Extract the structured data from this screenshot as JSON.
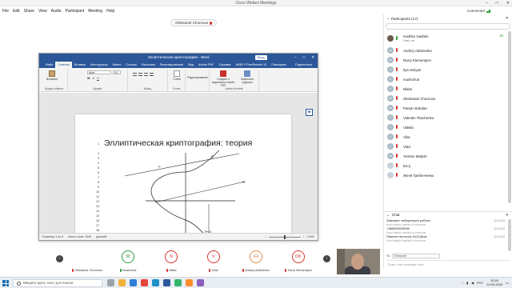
{
  "webex": {
    "title": "Cisco Webex Meetings",
    "menu": [
      "File",
      "Edit",
      "Share",
      "View",
      "Audio",
      "Participant",
      "Meeting",
      "Help"
    ],
    "connection_status": "Connected",
    "window_controls": [
      "–",
      "□",
      "✕"
    ]
  },
  "speaker_label": "Oleksandr Chornous",
  "word": {
    "title": "Эллиптическая криптография - Word",
    "signin_label": "Вход",
    "window_controls": [
      "–",
      "□",
      "✕"
    ],
    "tabs": [
      "Файл",
      "Главная",
      "Вставка",
      "Конструктор",
      "Макет",
      "Ссылки",
      "Рассылки",
      "Рецензирование",
      "Вид",
      "Adobe PDF",
      "Справка",
      "ABBYY FineReader 12",
      "Помощник"
    ],
    "active_tab": "Главная",
    "share_label": "Поделиться",
    "ribbon": {
      "paste_label": "Вставить",
      "clipboard_group": "Буфер обмена",
      "font_name": "Arial",
      "font_size": "14",
      "font_group": "Шрифт",
      "paragraph_group": "Абзац",
      "styles_label": "Стили",
      "styles_group": "Стили",
      "editing_label": "Редактирование",
      "pdf_label": "Создать и поделиться Adobe PDF",
      "sign_label": "Запросить подписи",
      "acrobat_group": "Adobe Acrobat"
    },
    "nav_icon": "bookmark-icon",
    "document": {
      "heading": "Эллиптическая криптография: теория",
      "line_numbers": [
        "1",
        "",
        "2",
        "3",
        "4",
        "5",
        "6",
        "7",
        "8",
        "9",
        "10",
        "11",
        "12",
        "13",
        "14",
        "15",
        "16",
        "17",
        "18"
      ],
      "diagram_labels": {
        "q": "Q",
        "p": "P",
        "r": "-R",
        "result": "P+Q"
      }
    },
    "status": {
      "page": "Страница 1 из 6",
      "words": "Число слов: 1946",
      "language": "русский",
      "zoom": "100%"
    }
  },
  "participants_panel": {
    "header": "Participants (17)",
    "close_icon": "close-icon",
    "participants": [
      {
        "name": "Ivashko Ivashko",
        "sub": "Host, me",
        "initials": "",
        "avatar": "photo",
        "mic": "green",
        "tail": "28"
      },
      {
        "name": "Andrey Adamenko",
        "initials": "AA",
        "avatar": "initials",
        "mic": "muted"
      },
      {
        "name": "Darry Klementyev",
        "initials": "DK",
        "avatar": "initials",
        "mic": "muted"
      },
      {
        "name": "Ilya Sniiyan",
        "initials": "IS",
        "avatar": "initials",
        "mic": "muted"
      },
      {
        "name": "mushchuk",
        "initials": "M",
        "avatar": "initials",
        "mic": "muted"
      },
      {
        "name": "Nikita",
        "initials": "N",
        "avatar": "initials",
        "mic": "muted"
      },
      {
        "name": "Oleksandr Chornous",
        "initials": "OC",
        "avatar": "initials",
        "mic": "muted"
      },
      {
        "name": "Patrylo Bokdan",
        "initials": "PB",
        "avatar": "initials",
        "mic": "muted"
      },
      {
        "name": "Valentin Tkachenko",
        "initials": "VT",
        "avatar": "initials",
        "mic": "muted"
      },
      {
        "name": "Valeila",
        "initials": "V",
        "avatar": "initials",
        "mic": "muted"
      },
      {
        "name": "Vika",
        "initials": "V",
        "avatar": "initials",
        "mic": "muted"
      },
      {
        "name": "Vlad",
        "initials": "V",
        "avatar": "initials",
        "mic": "muted"
      },
      {
        "name": "Yevhen Malysh",
        "initials": "YM",
        "avatar": "initials",
        "mic": "muted"
      },
      {
        "name": "Enoj",
        "initials": "",
        "avatar": "user",
        "mic": "muted"
      },
      {
        "name": "Женя Гребенченко",
        "initials": "",
        "avatar": "user",
        "mic": "muted"
      }
    ]
  },
  "chat": {
    "header": "Chat",
    "messages": [
      {
        "text": "Закинуте лабораторні роботи",
        "from": "from Ivashko Ivashko to everyone",
        "time": "10:02 AM"
      },
      {
        "text": "+380505025690",
        "from": "from Ivashko Ivashko to everyone",
        "time": "10:02 AM"
      },
      {
        "text": "Пишите на почту tr121@ua",
        "from": "from Ivashko Ivashko to everyone",
        "time": "10:02 AM"
      }
    ],
    "to_label": "To:",
    "to_value": "Everyone",
    "input_placeholder": "Enter chat message here"
  },
  "filmstrip": [
    {
      "initials": "",
      "name": "Oleksandr Chornous",
      "mic": "muted"
    },
    {
      "initials": "M",
      "name": "mushchuk",
      "mic": "green"
    },
    {
      "initials": "N",
      "name": "Nikita",
      "mic": "muted"
    },
    {
      "initials": "V",
      "name": "Vlad",
      "mic": "muted"
    },
    {
      "initials": "AA",
      "name": "Andrey Adamenko",
      "mic": "muted"
    },
    {
      "initials": "DK",
      "name": "Darry Klementyev",
      "mic": "muted"
    }
  ],
  "taskbar": {
    "search_placeholder": "Введите здесь текст для поиска",
    "language": "РУС",
    "time": "10:24",
    "date": "13.04.2020"
  },
  "colors": {
    "word_blue": "#2b579a",
    "muted_red": "#d9332b",
    "unmuted_green": "#2d9c3c",
    "tile_colors": [
      "#7a7a7a",
      "#2d9c3c",
      "#d9332b",
      "#d9332b",
      "#e08a4c",
      "#d9332b"
    ]
  }
}
